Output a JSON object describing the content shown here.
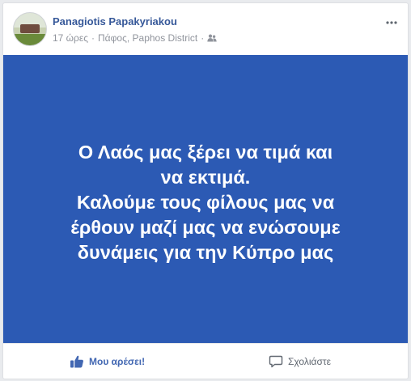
{
  "post": {
    "author": "Panagiotis Papakyriakou",
    "time": "17 ώρες",
    "separator": "·",
    "location": "Πάφος, Paphos District",
    "privacy_icon": "friends-icon",
    "text_lines": [
      "Ο Λαός μας ξέρει να τιμά και",
      "να εκτιμά.",
      "Καλούμε τους φίλους μας να",
      "έρθουν μαζί μας να ενώσουμε",
      "δυνάμεις για την Κύπρο μας"
    ],
    "background_color": "#2c5ab4"
  },
  "actions": {
    "like_label": "Μου αρέσει!",
    "comment_label": "Σχολιάστε"
  },
  "colors": {
    "author_name": "#365899",
    "like_action": "#4267b2",
    "meta_text": "#90949c"
  }
}
